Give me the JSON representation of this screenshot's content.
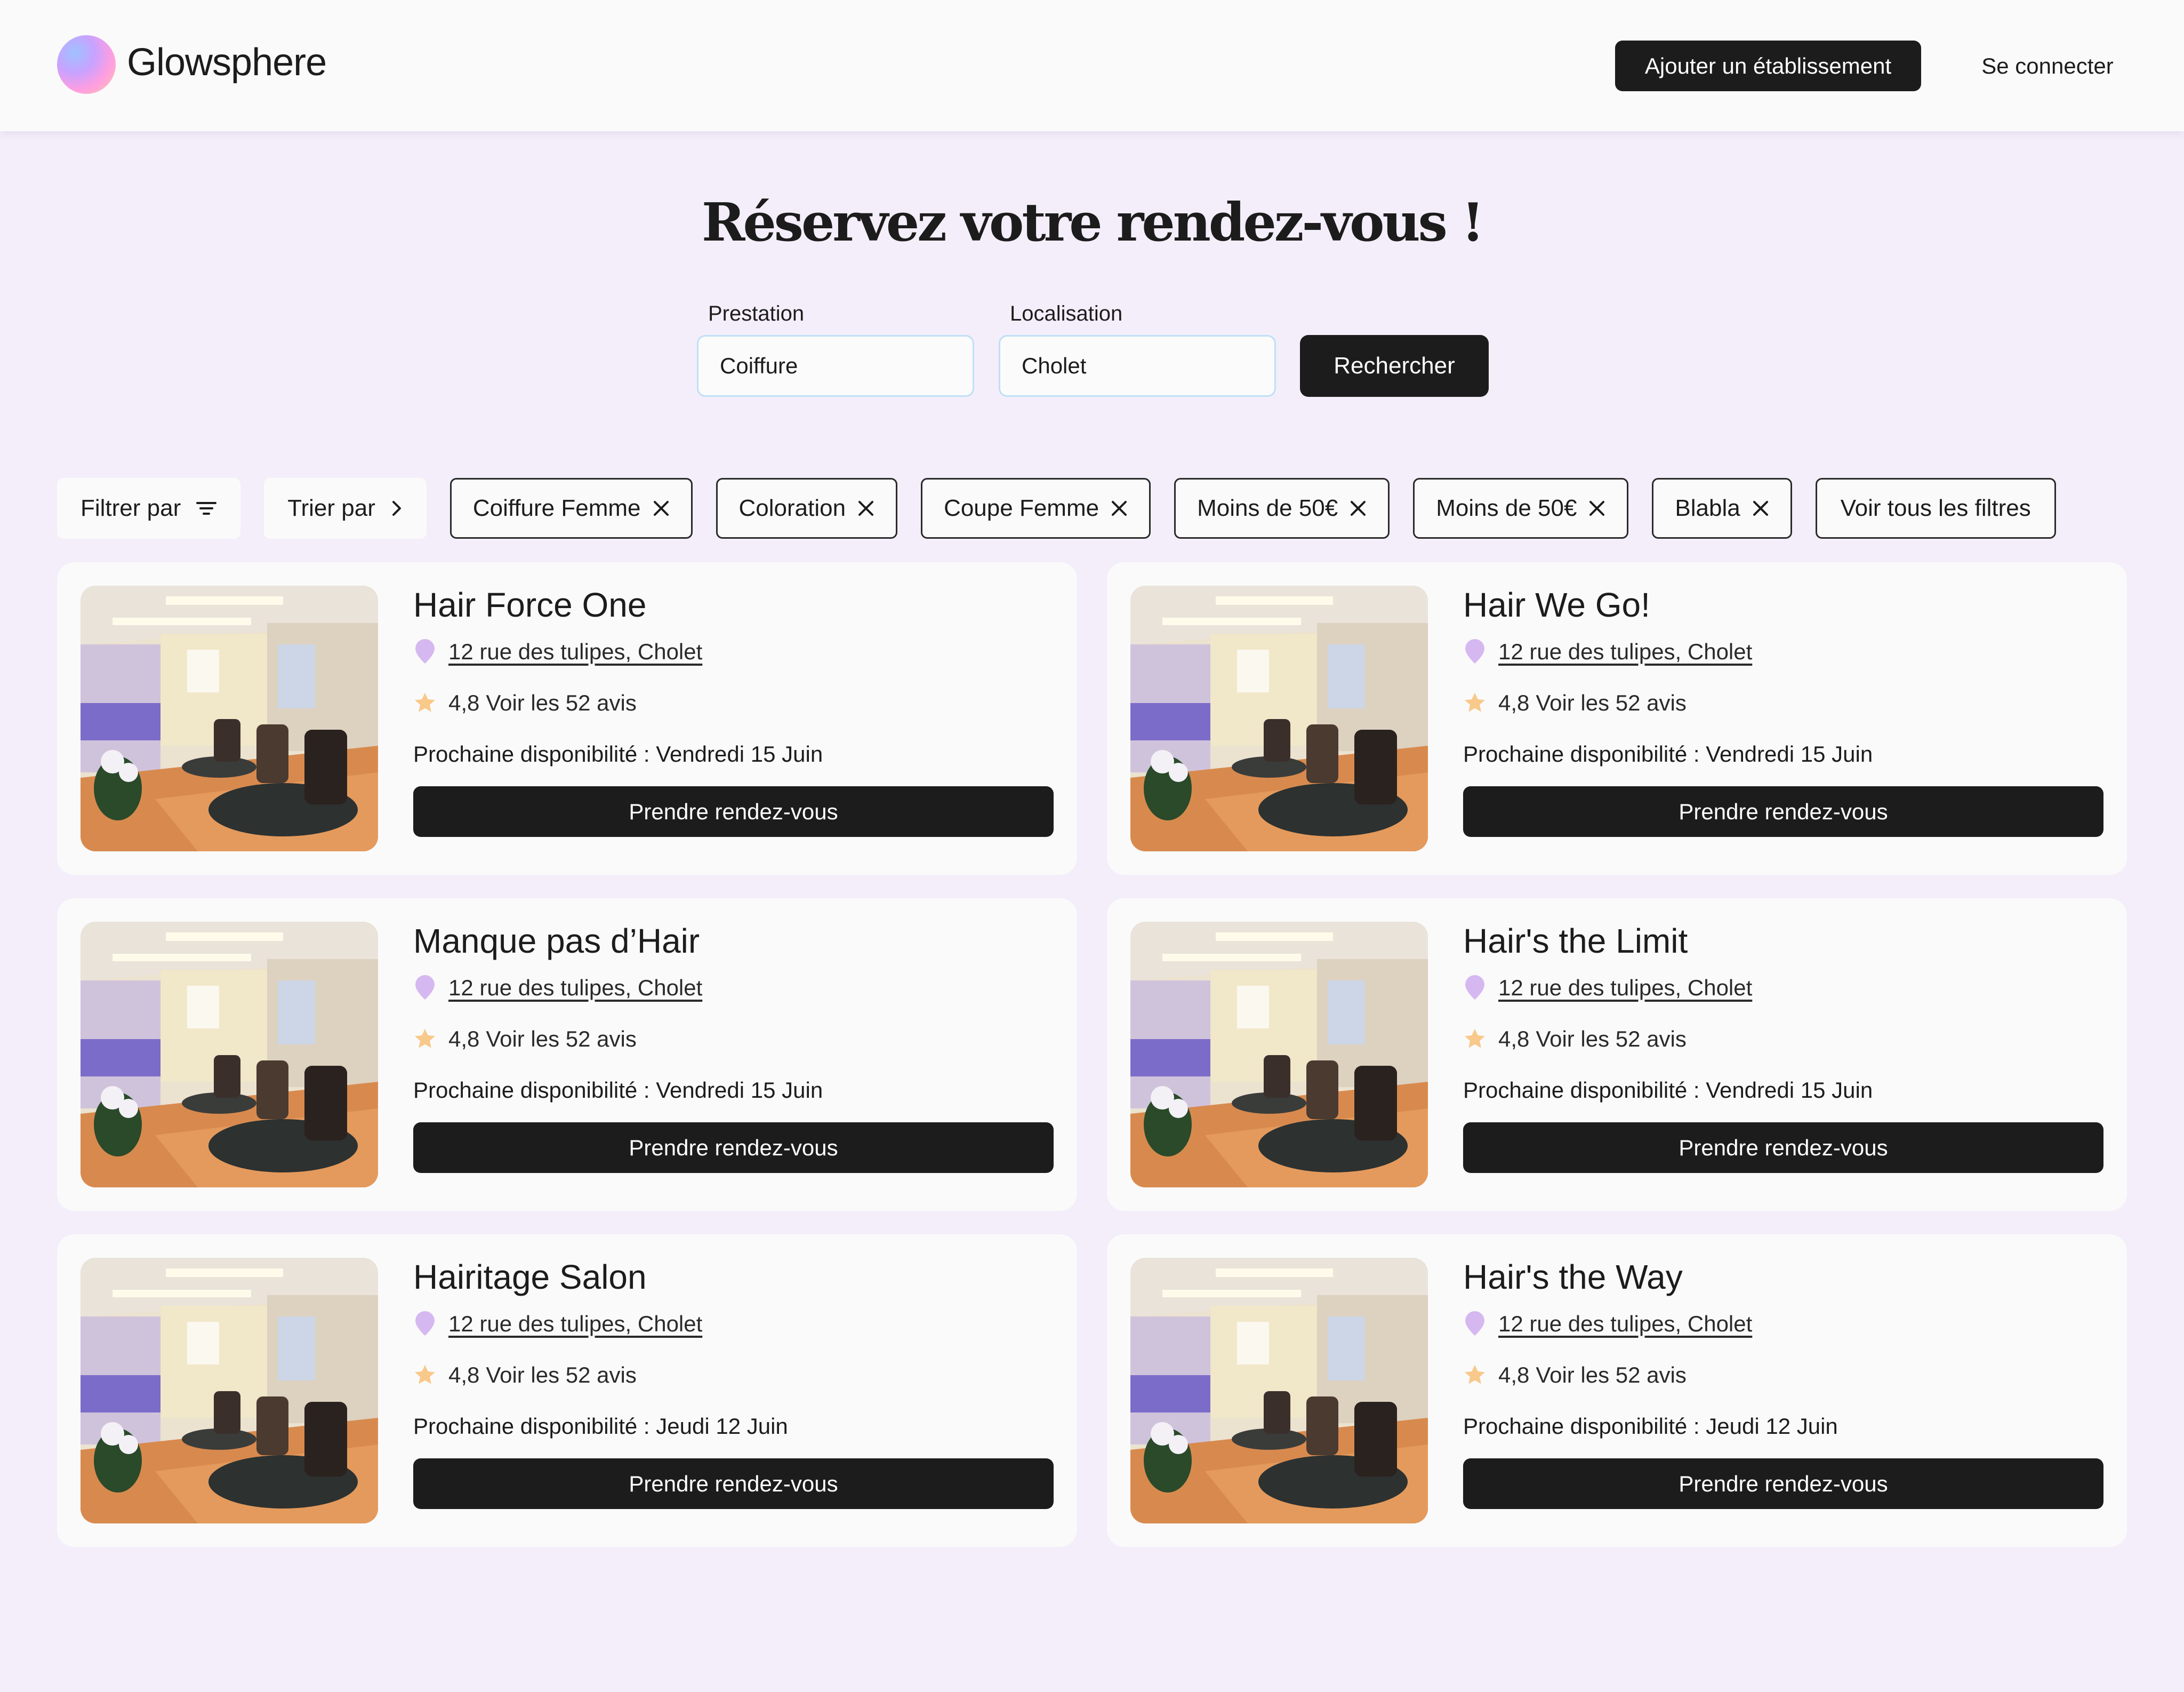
{
  "header": {
    "brand": "Glowsphere",
    "add_business_label": "Ajouter un établissement",
    "login_label": "Se connecter"
  },
  "hero": {
    "title": "Réservez votre rendez-vous !",
    "service_label": "Prestation",
    "service_value": "Coiffure",
    "location_label": "Localisation",
    "location_value": "Cholet",
    "search_label": "Rechercher"
  },
  "filters": {
    "filter_label": "Filtrer par",
    "sort_label": "Trier par",
    "chips": [
      "Coiffure Femme",
      "Coloration",
      "Coupe Femme",
      "Moins de 50€",
      "Moins de 50€",
      "Blabla"
    ],
    "see_all_label": "Voir tous les filtres"
  },
  "colors": {
    "accent": "#1c1c1c",
    "background": "#f4eefb",
    "pin": "#d5b8f0",
    "star": "#f8c98a",
    "input_border": "#bfe0f5"
  },
  "salons": [
    {
      "name": "Hair Force One",
      "address": "12 rue des tulipes, Cholet",
      "rating": "4,8",
      "reviews": "Voir les 52 avis",
      "availability": "Prochaine disponibilité : Vendredi 15 Juin",
      "button": "Prendre rendez-vous"
    },
    {
      "name": "Hair We Go!",
      "address": "12 rue des tulipes, Cholet",
      "rating": "4,8",
      "reviews": "Voir les 52 avis",
      "availability": "Prochaine disponibilité : Vendredi 15 Juin",
      "button": "Prendre rendez-vous"
    },
    {
      "name": "Manque pas d’Hair",
      "address": "12 rue des tulipes, Cholet",
      "rating": "4,8",
      "reviews": "Voir les 52 avis",
      "availability": "Prochaine disponibilité : Vendredi 15 Juin",
      "button": "Prendre rendez-vous"
    },
    {
      "name": "Hair's the Limit",
      "address": "12 rue des tulipes, Cholet",
      "rating": "4,8",
      "reviews": "Voir les 52 avis",
      "availability": "Prochaine disponibilité : Vendredi 15 Juin",
      "button": "Prendre rendez-vous"
    },
    {
      "name": "Hairitage Salon",
      "address": "12 rue des tulipes, Cholet",
      "rating": "4,8",
      "reviews": "Voir les 52 avis",
      "availability": "Prochaine disponibilité : Jeudi 12 Juin",
      "button": "Prendre rendez-vous"
    },
    {
      "name": "Hair's the Way",
      "address": "12 rue des tulipes, Cholet",
      "rating": "4,8",
      "reviews": "Voir les 52 avis",
      "availability": "Prochaine disponibilité : Jeudi 12 Juin",
      "button": "Prendre rendez-vous"
    }
  ]
}
